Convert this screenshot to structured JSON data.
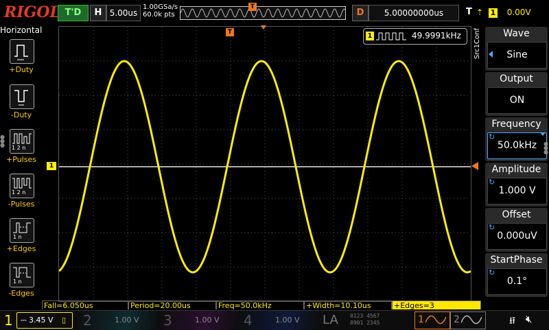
{
  "brand": {
    "logo_prefix": "RIG",
    "logo_suffix": "OL"
  },
  "top": {
    "run_mode": "T'D",
    "horizontal_label": "H",
    "timebase": "5.00us",
    "sample_rate": "1.00GSa/s",
    "memory_points": "60.0k pts",
    "trigger_marker": "T",
    "delay_label": "D",
    "delay_value": "5.00000000us",
    "trigger_type_label": "T",
    "trigger_channel": "1",
    "trigger_level": "0.00V"
  },
  "left_panel": {
    "title": "Horizontal",
    "items": [
      {
        "label": "+Duty",
        "icon": "positive-duty-icon"
      },
      {
        "label": "-Duty",
        "icon": "negative-duty-icon"
      },
      {
        "label": "+Pulses",
        "icon": "positive-pulses-icon",
        "sub": "1 2  n"
      },
      {
        "label": "-Pulses",
        "icon": "negative-pulses-icon",
        "sub": "1 2  n"
      },
      {
        "label": "+Edges",
        "icon": "positive-edges-icon",
        "sub": "1    n"
      },
      {
        "label": "-Edges",
        "icon": "negative-edges-icon",
        "sub": "1    n"
      }
    ]
  },
  "display": {
    "trigger_top_marker": "T",
    "ch1_marker": "1",
    "counter_channel": "1",
    "counter_value": "49.9991kHz",
    "waveform_color": "#ffee00",
    "grid_color": "#555555"
  },
  "right_panel": {
    "title": "Src1Conf",
    "items": [
      {
        "name": "Wave",
        "value": "Sine"
      },
      {
        "name": "Output",
        "value": "ON"
      },
      {
        "name": "Frequency",
        "value": "50.0kHz"
      },
      {
        "name": "Amplitude",
        "value": "1.000 V"
      },
      {
        "name": "Offset",
        "value": "0.000uV"
      },
      {
        "name": "StartPhase",
        "value": "0.1°"
      }
    ]
  },
  "measurements": [
    "Fall=6.050us",
    "Period=20.00us",
    "Freq=50.0kHz",
    "+Width=10.10us",
    "+Edges=3"
  ],
  "bottom": {
    "ch1": {
      "num": "1",
      "coupling": "⎓",
      "scale": "3.45 V",
      "color": "#ffee00"
    },
    "ch2": {
      "num": "2",
      "scale": "1.00 V",
      "color": "#00c0ff"
    },
    "ch3": {
      "num": "3",
      "scale": "1.00 V",
      "color": "#ff40ff"
    },
    "ch4": {
      "num": "4",
      "scale": "1.00 V",
      "color": "#3060ff"
    },
    "la_label": "LA",
    "la_row1": "0123  4567",
    "la_row2": "8901  2345",
    "src1_num": "1",
    "src2_num": "2"
  },
  "waveform_scope": {
    "frequency_hz": 50000,
    "cycles_on_screen": 3
  }
}
